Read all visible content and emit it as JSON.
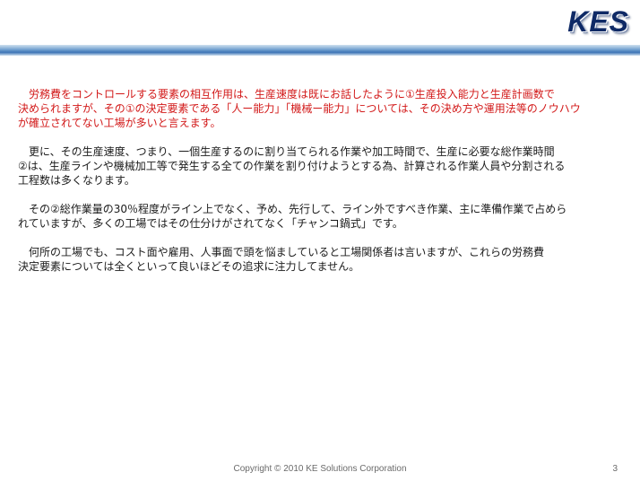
{
  "logo": {
    "text": "KES"
  },
  "paragraphs": [
    "　労務費をコントロールする要素の相互作用は、生産速度は既にお話したように①生産投入能力と生産計画数で\n決められますが、その①の決定要素である「人ー能力」「機械ー能力」については、その決め方や運用法等のノウハウ\nが確立されてない工場が多いと言えます。",
    "　更に、その生産速度、つまり、一個生産するのに割り当てられる作業や加工時間で、生産に必要な総作業時間\n②は、生産ラインや機械加工等で発生する全ての作業を割り付けようとする為、計算される作業人員や分割される\n工程数は多くなります。",
    "　その②総作業量の30％程度がライン上でなく、予め、先行して、ライン外ですべき作業、主に準備作業で占めら\nれていますが、多くの工場ではその仕分けがされてなく「チャンコ鍋式」です。",
    "　何所の工場でも、コスト面や雇用、人事面で頭を悩ましていると工場関係者は言いますが、これらの労務費\n決定要素については全くといって良いほどその追求に注力してません。"
  ],
  "footer": {
    "copyright": "Copyright   © 2010 KE Solutions  Corporation",
    "page_number": "3"
  },
  "colors": {
    "accent_red": "#d21818",
    "logo_navy": "#0f2a66",
    "header_bar_blue": "#3d74b5"
  }
}
